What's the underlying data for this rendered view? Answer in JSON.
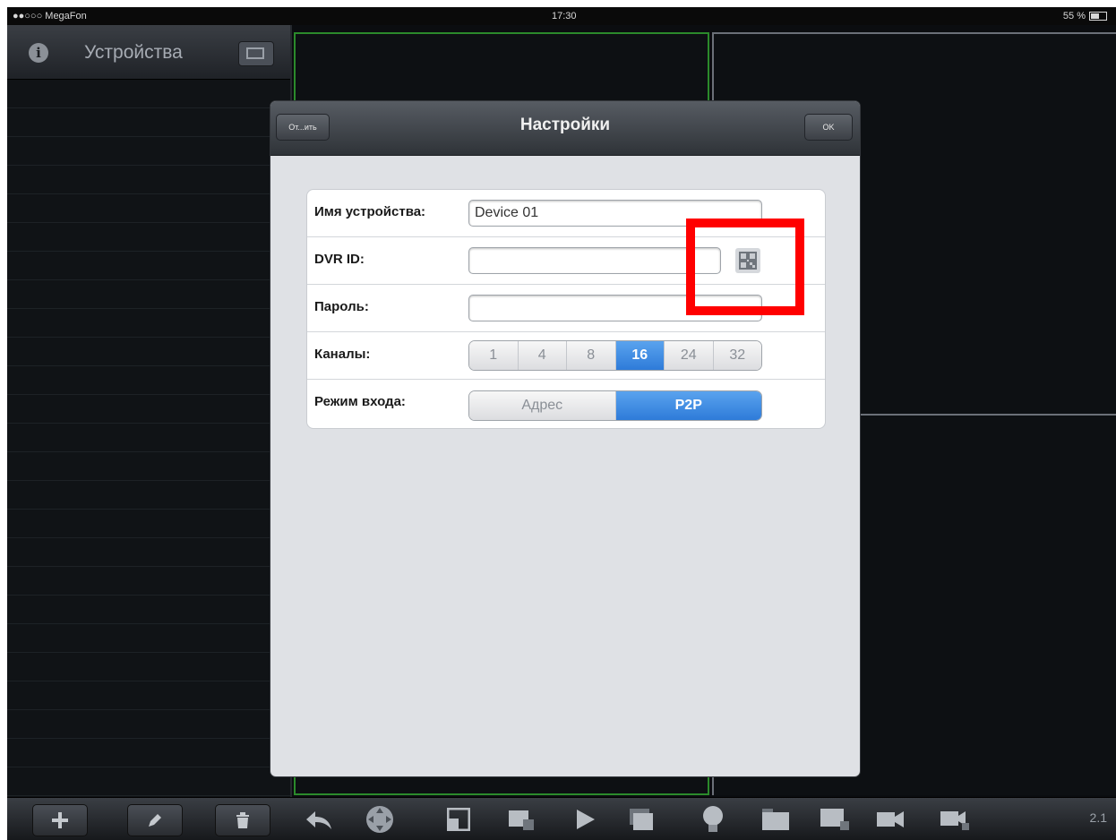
{
  "status_bar": {
    "carrier": "●●○○○ MegaFon",
    "time": "17:30",
    "battery": "55 %"
  },
  "sidebar": {
    "title": "Устройства"
  },
  "dialog": {
    "title": "Настройки",
    "cancel_label": "От...ить",
    "ok_label": "OK",
    "fields": {
      "device_name": {
        "label": "Имя устройства:",
        "value": "Device 01"
      },
      "dvr_id": {
        "label": "DVR ID:",
        "value": ""
      },
      "password": {
        "label": "Пароль:",
        "value": ""
      },
      "channels": {
        "label": "Каналы:",
        "options": [
          "1",
          "4",
          "8",
          "16",
          "24",
          "32"
        ],
        "selected": "16"
      },
      "login_mode": {
        "label": "Режим входа:",
        "options": [
          "Адрес",
          "P2P"
        ],
        "selected": "P2P"
      }
    }
  },
  "toolbar": {
    "page_indicator": "2.1"
  },
  "colors": {
    "accent_blue": "#2e7bd9",
    "highlight_red": "#ff0000",
    "active_pane_border": "#2b8a2b"
  },
  "icons": {
    "toolbar": [
      "plus-icon",
      "edit-icon",
      "trash-icon",
      "back-icon",
      "ptz-icon",
      "layout-icon",
      "record-icon",
      "play-icon",
      "gallery-icon",
      "light-icon",
      "folder-icon",
      "screenshot-icon",
      "video-icon",
      "video-audio-icon"
    ]
  }
}
